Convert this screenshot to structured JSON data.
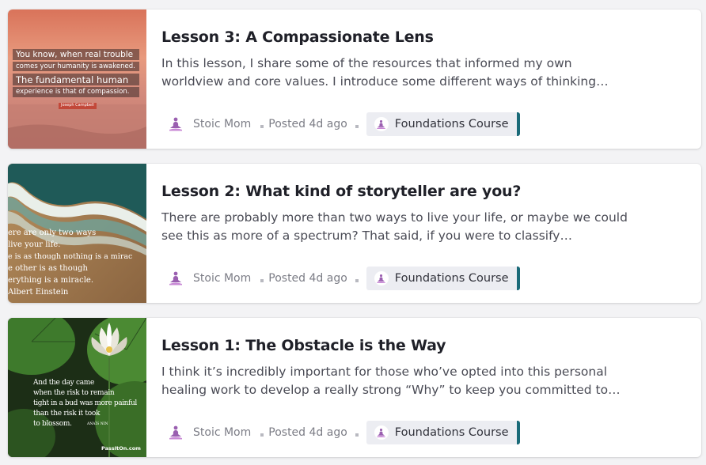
{
  "lessons": [
    {
      "title": "Lesson 3: A Compassionate Lens",
      "excerpt": "In this lesson, I share some of the resources that informed my own worldview and core values. I introduce some different ways of thinking…",
      "author": "Stoic Mom",
      "posted": "Posted 4d ago",
      "tag": "Foundations Course",
      "thumb_quote": [
        "You know, when real trouble",
        "comes your humanity is awakened.",
        "The fundamental human",
        "experience is that of compassion."
      ],
      "thumb_credit": "Joseph Campbell"
    },
    {
      "title": "Lesson 2: What kind of storyteller are you?",
      "excerpt": "There are probably more than two ways to live your life, or maybe we could see this as more of a spectrum? That said, if you were to classify…",
      "author": "Stoic Mom",
      "posted": "Posted 4d ago",
      "tag": "Foundations Course",
      "thumb_quote": [
        "ere are only two ways",
        "live your life.",
        "e is as though nothing is a mirac",
        "e other is as though",
        "erything is a miracle."
      ],
      "thumb_credit": "Albert Einstein"
    },
    {
      "title": "Lesson 1: The Obstacle is the Way",
      "excerpt": "I think it’s incredibly important for those who’ve opted into this personal healing work to develop a really strong “Why” to keep you committed to…",
      "author": "Stoic Mom",
      "posted": "Posted 4d ago",
      "tag": "Foundations Course",
      "thumb_quote": [
        "And the day came",
        "when the risk to remain",
        "tight in a bud was more painful",
        "than the risk it took",
        "to blossom."
      ],
      "thumb_credit": "ANAÏS NIN",
      "thumb_brand": "PassItOn.com"
    }
  ],
  "colors": {
    "tag_accent": "#1a6a78",
    "avatar": "#9a5fb0"
  },
  "icons": [
    "meditation-avatar-icon"
  ]
}
